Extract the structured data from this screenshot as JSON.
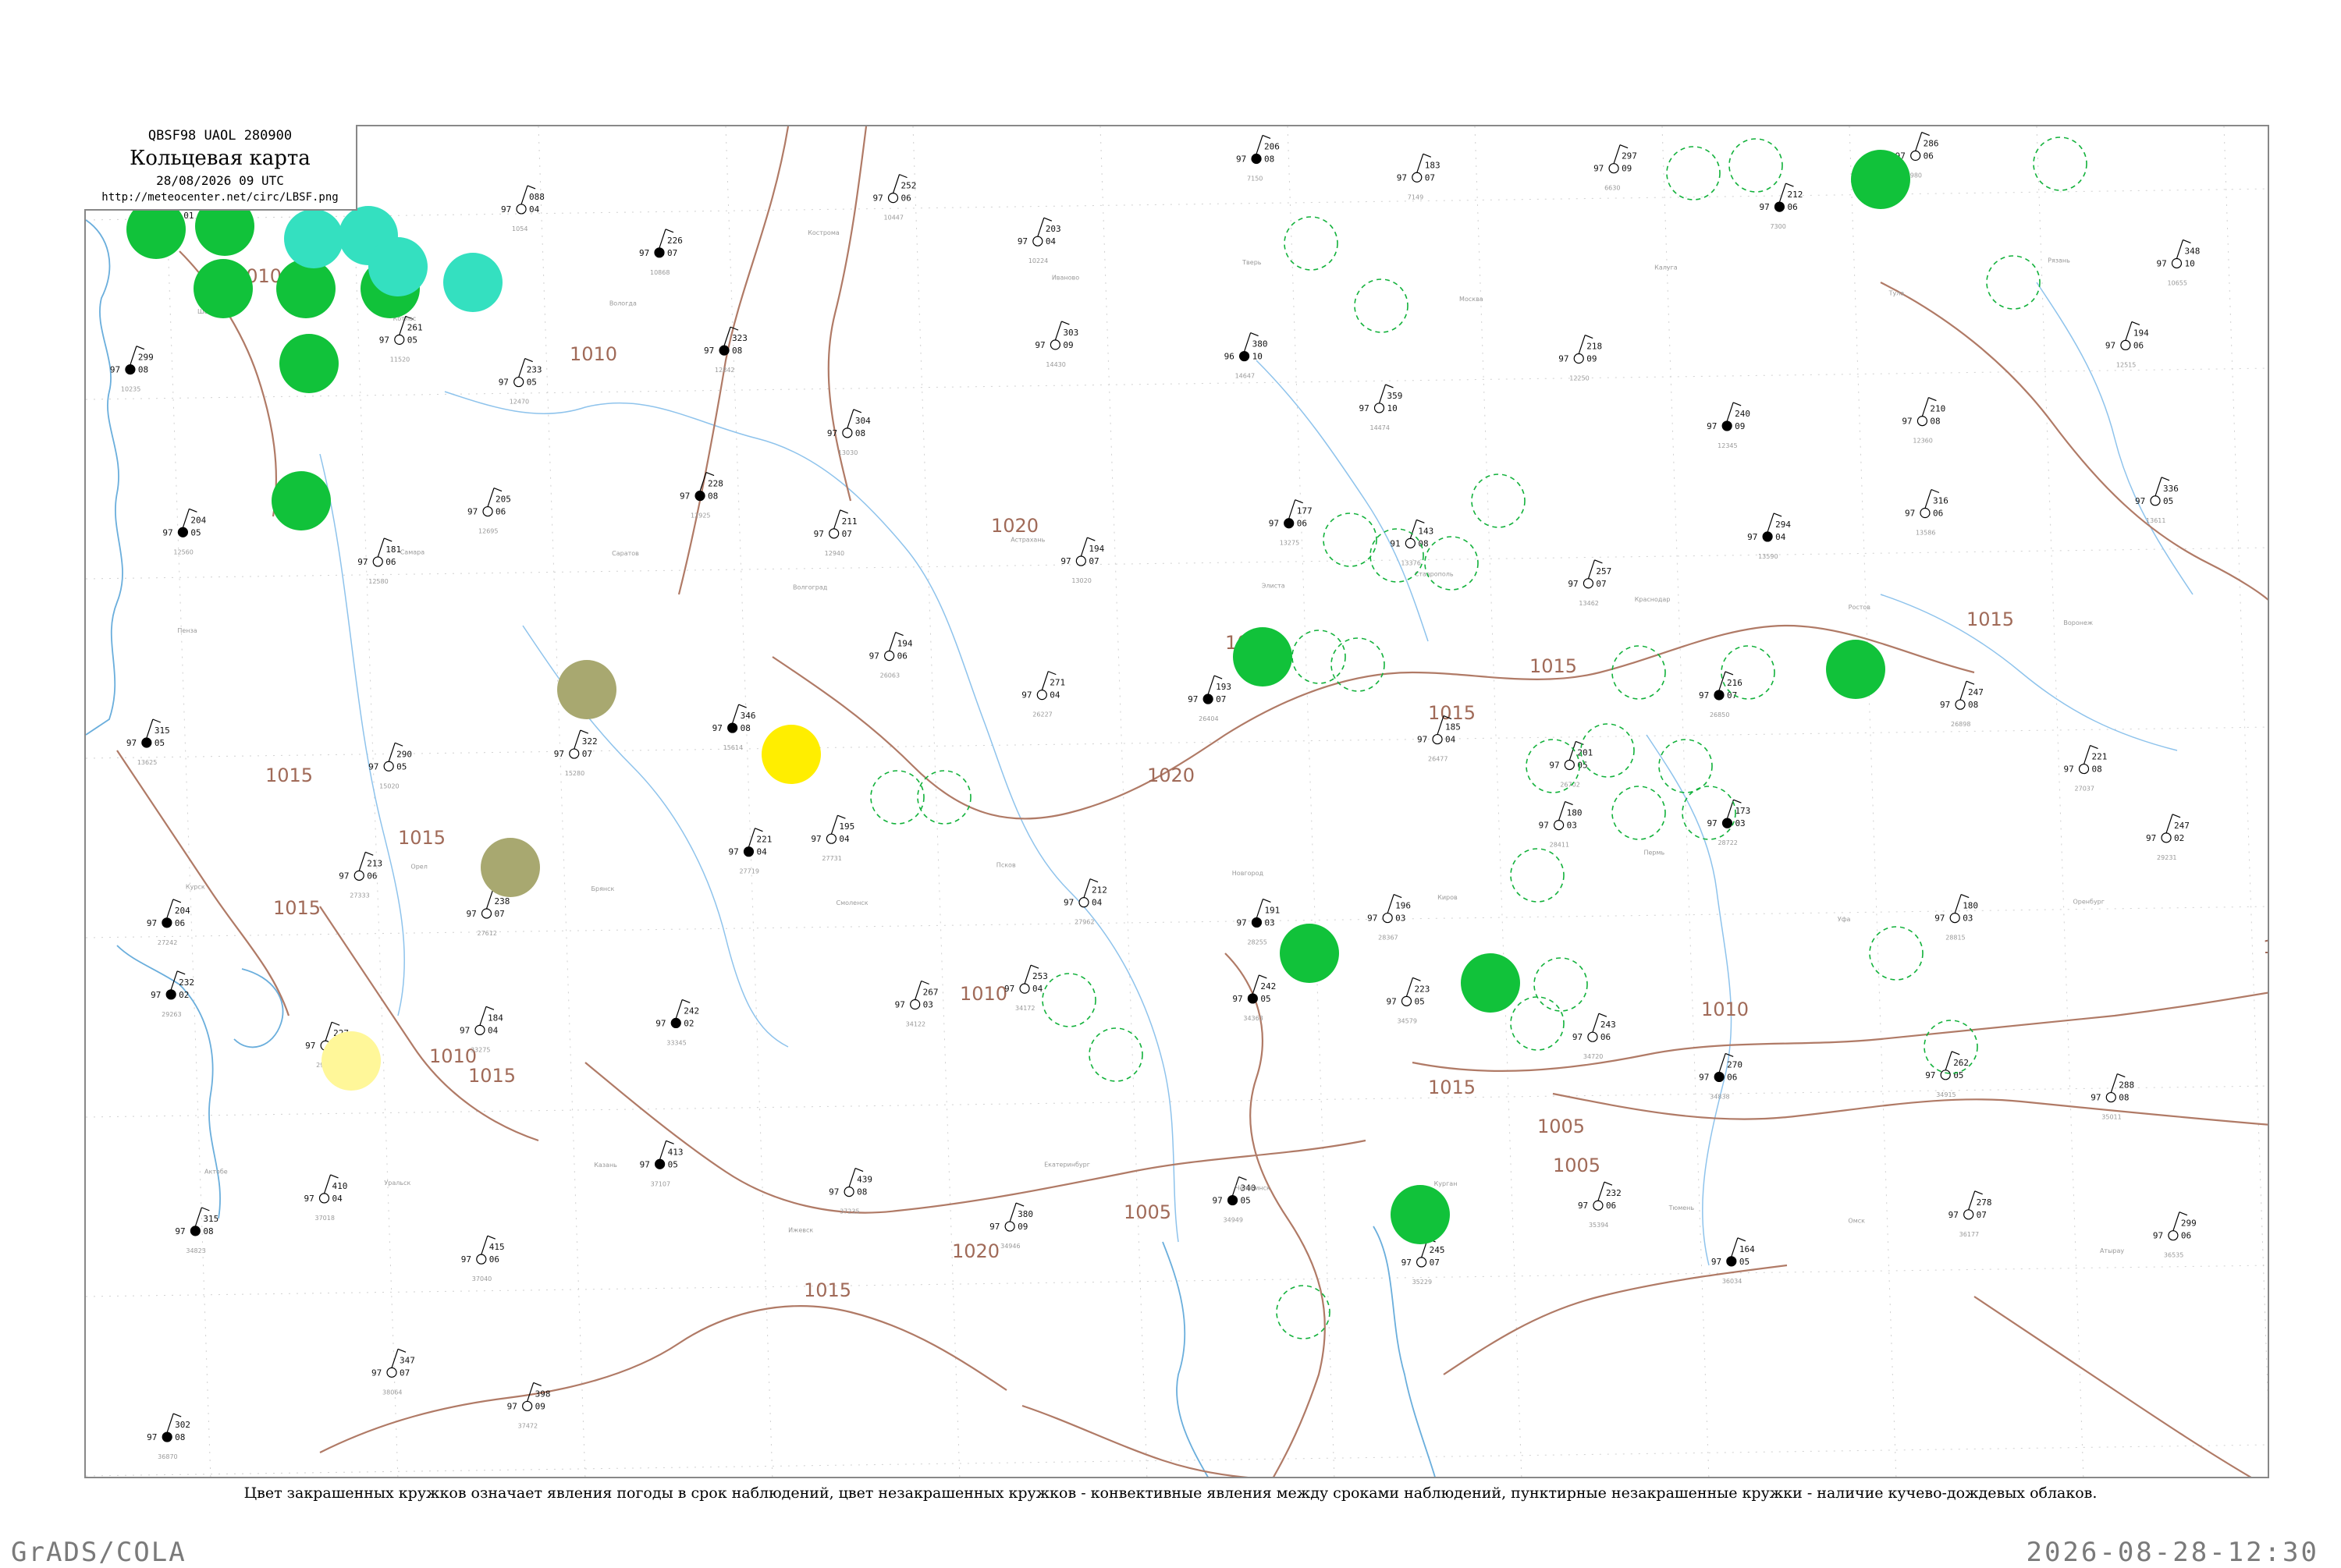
{
  "title": {
    "code": "QBSF98  UAOL  280900",
    "main": "Кольцевая карта",
    "date": "28/08/2026 09 UTC",
    "url": "http://meteocenter.net/circ/LBSF.png"
  },
  "caption": "Цвет закрашенных кружков означает явления погоды в срок наблюдений, цвет незакрашенных кружков - конвективные явления между сроками наблюдений, пунктирные незакрашенные кружки - наличие кучево-дождевых облаков.",
  "footer": {
    "left": "GrADS/COLA",
    "right": "2026-08-28-12:30"
  },
  "colors": {
    "isobar": "#b07a66",
    "water": "#6aaedc",
    "rain": "#11c23a",
    "shower_rain": "#34e0c0",
    "fog_olive": "#a8a870",
    "haze_yellow": "#ffee00",
    "pale_yellow": "#fff799",
    "cb_dashed": "#11b13a"
  },
  "isobar_labels": [
    {
      "text": "1010"
    },
    {
      "text": "1010"
    },
    {
      "text": "1010"
    },
    {
      "text": "1010"
    },
    {
      "text": "1015"
    },
    {
      "text": "1015"
    },
    {
      "text": "1015"
    },
    {
      "text": "1015"
    },
    {
      "text": "1015"
    },
    {
      "text": "1015"
    },
    {
      "text": "1015"
    },
    {
      "text": "1015"
    },
    {
      "text": "1020"
    },
    {
      "text": "1020"
    },
    {
      "text": "1020"
    },
    {
      "text": "1020"
    },
    {
      "text": "1005"
    },
    {
      "text": "1005"
    },
    {
      "text": "1005"
    },
    {
      "text": "1010"
    },
    {
      "text": "1010"
    },
    {
      "text": "1015"
    }
  ],
  "stations": [
    {
      "p": "109",
      "t": "97",
      "d": "-01",
      "id": "4221"
    },
    {
      "p": "099",
      "t": "97",
      "d": "05",
      "id": "2652"
    },
    {
      "p": "088",
      "t": "97",
      "d": "04",
      "id": "1054"
    },
    {
      "p": "226",
      "t": "97",
      "d": "07",
      "id": "10868"
    },
    {
      "p": "252",
      "t": "97",
      "d": "06",
      "id": "10447"
    },
    {
      "p": "203",
      "t": "97",
      "d": "04",
      "id": "10224"
    },
    {
      "p": "206",
      "t": "97",
      "d": "08",
      "id": "7150"
    },
    {
      "p": "183",
      "t": "97",
      "d": "07",
      "id": "7149"
    },
    {
      "p": "297",
      "t": "97",
      "d": "09",
      "id": "6630"
    },
    {
      "p": "212",
      "t": "97",
      "d": "06",
      "id": "7300"
    },
    {
      "p": "286",
      "t": "97",
      "d": "06",
      "id": "6980"
    },
    {
      "p": "348",
      "t": "97",
      "d": "10",
      "id": "10655"
    },
    {
      "p": "299",
      "t": "97",
      "d": "08",
      "id": "10235"
    },
    {
      "p": "261",
      "t": "97",
      "d": "05",
      "id": "11520"
    },
    {
      "p": "233",
      "t": "97",
      "d": "05",
      "id": "12470"
    },
    {
      "p": "323",
      "t": "97",
      "d": "08",
      "id": "12842"
    },
    {
      "p": "304",
      "t": "97",
      "d": "08",
      "id": "13030"
    },
    {
      "p": "303",
      "t": "97",
      "d": "09",
      "id": "14430"
    },
    {
      "p": "380",
      "t": "96",
      "d": "10",
      "id": "14647"
    },
    {
      "p": "359",
      "t": "97",
      "d": "10",
      "id": "14474"
    },
    {
      "p": "218",
      "t": "97",
      "d": "09",
      "id": "12250"
    },
    {
      "p": "240",
      "t": "97",
      "d": "09",
      "id": "12345"
    },
    {
      "p": "210",
      "t": "97",
      "d": "08",
      "id": "12360"
    },
    {
      "p": "194",
      "t": "97",
      "d": "06",
      "id": "12515"
    },
    {
      "p": "204",
      "t": "97",
      "d": "05",
      "id": "12560"
    },
    {
      "p": "181",
      "t": "97",
      "d": "06",
      "id": "12580"
    },
    {
      "p": "205",
      "t": "97",
      "d": "06",
      "id": "12695"
    },
    {
      "p": "228",
      "t": "97",
      "d": "08",
      "id": "12925"
    },
    {
      "p": "211",
      "t": "97",
      "d": "07",
      "id": "12940"
    },
    {
      "p": "194",
      "t": "97",
      "d": "07",
      "id": "13020"
    },
    {
      "p": "177",
      "t": "97",
      "d": "06",
      "id": "13275"
    },
    {
      "p": "143",
      "t": "91",
      "d": "08",
      "id": "13376"
    },
    {
      "p": "257",
      "t": "97",
      "d": "07",
      "id": "13462"
    },
    {
      "p": "294",
      "t": "97",
      "d": "04",
      "id": "13590"
    },
    {
      "p": "316",
      "t": "97",
      "d": "06",
      "id": "13586"
    },
    {
      "p": "336",
      "t": "97",
      "d": "05",
      "id": "13611"
    },
    {
      "p": "315",
      "t": "97",
      "d": "05",
      "id": "13625"
    },
    {
      "p": "290",
      "t": "97",
      "d": "05",
      "id": "15020"
    },
    {
      "p": "322",
      "t": "97",
      "d": "07",
      "id": "15280"
    },
    {
      "p": "346",
      "t": "97",
      "d": "08",
      "id": "15614"
    },
    {
      "p": "194",
      "t": "97",
      "d": "06",
      "id": "26063"
    },
    {
      "p": "271",
      "t": "97",
      "d": "04",
      "id": "26227"
    },
    {
      "p": "193",
      "t": "97",
      "d": "07",
      "id": "26404"
    },
    {
      "p": "185",
      "t": "97",
      "d": "04",
      "id": "26477"
    },
    {
      "p": "201",
      "t": "97",
      "d": "05",
      "id": "26702"
    },
    {
      "p": "216",
      "t": "97",
      "d": "07",
      "id": "26850"
    },
    {
      "p": "247",
      "t": "97",
      "d": "08",
      "id": "26898"
    },
    {
      "p": "221",
      "t": "97",
      "d": "08",
      "id": "27037"
    },
    {
      "p": "204",
      "t": "97",
      "d": "06",
      "id": "27242"
    },
    {
      "p": "213",
      "t": "97",
      "d": "06",
      "id": "27333"
    },
    {
      "p": "238",
      "t": "97",
      "d": "07",
      "id": "27612"
    },
    {
      "p": "221",
      "t": "97",
      "d": "04",
      "id": "27719"
    },
    {
      "p": "195",
      "t": "97",
      "d": "04",
      "id": "27731"
    },
    {
      "p": "212",
      "t": "97",
      "d": "04",
      "id": "27962"
    },
    {
      "p": "191",
      "t": "97",
      "d": "03",
      "id": "28255"
    },
    {
      "p": "196",
      "t": "97",
      "d": "03",
      "id": "28367"
    },
    {
      "p": "180",
      "t": "97",
      "d": "03",
      "id": "28411"
    },
    {
      "p": "173",
      "t": "97",
      "d": "03",
      "id": "28722"
    },
    {
      "p": "180",
      "t": "97",
      "d": "03",
      "id": "28815"
    },
    {
      "p": "247",
      "t": "97",
      "d": "02",
      "id": "29231"
    },
    {
      "p": "232",
      "t": "97",
      "d": "02",
      "id": "29263"
    },
    {
      "p": "227",
      "t": "97",
      "d": "02",
      "id": "29572"
    },
    {
      "p": "184",
      "t": "97",
      "d": "04",
      "id": "33275"
    },
    {
      "p": "242",
      "t": "97",
      "d": "02",
      "id": "33345"
    },
    {
      "p": "267",
      "t": "97",
      "d": "03",
      "id": "34122"
    },
    {
      "p": "253",
      "t": "97",
      "d": "04",
      "id": "34172"
    },
    {
      "p": "242",
      "t": "97",
      "d": "05",
      "id": "34363"
    },
    {
      "p": "223",
      "t": "97",
      "d": "05",
      "id": "34579"
    },
    {
      "p": "243",
      "t": "97",
      "d": "06",
      "id": "34720"
    },
    {
      "p": "270",
      "t": "97",
      "d": "06",
      "id": "34838"
    },
    {
      "p": "262",
      "t": "97",
      "d": "05",
      "id": "34915"
    },
    {
      "p": "288",
      "t": "97",
      "d": "08",
      "id": "35011"
    },
    {
      "p": "315",
      "t": "97",
      "d": "08",
      "id": "34823"
    },
    {
      "p": "410",
      "t": "97",
      "d": "04",
      "id": "37018"
    },
    {
      "p": "415",
      "t": "97",
      "d": "06",
      "id": "37040"
    },
    {
      "p": "413",
      "t": "97",
      "d": "05",
      "id": "37107"
    },
    {
      "p": "439",
      "t": "97",
      "d": "08",
      "id": "37235"
    },
    {
      "p": "380",
      "t": "97",
      "d": "09",
      "id": "34946"
    },
    {
      "p": "340",
      "t": "97",
      "d": "05",
      "id": "34949"
    },
    {
      "p": "245",
      "t": "97",
      "d": "07",
      "id": "35229"
    },
    {
      "p": "232",
      "t": "97",
      "d": "06",
      "id": "35394"
    },
    {
      "p": "164",
      "t": "97",
      "d": "05",
      "id": "36034"
    },
    {
      "p": "278",
      "t": "97",
      "d": "07",
      "id": "36177"
    },
    {
      "p": "299",
      "t": "97",
      "d": "06",
      "id": "36535"
    },
    {
      "p": "302",
      "t": "97",
      "d": "08",
      "id": "36870"
    },
    {
      "p": "347",
      "t": "97",
      "d": "07",
      "id": "38064"
    },
    {
      "p": "398",
      "t": "97",
      "d": "09",
      "id": "37472"
    }
  ],
  "station_names": [
    "Шенкурск",
    "Котлас",
    "Вологда",
    "Кострома",
    "Иваново",
    "Тверь",
    "Москва",
    "Калуга",
    "Тула",
    "Рязань",
    "Пенза",
    "Самара",
    "Саратов",
    "Волгоград",
    "Астрахань",
    "Элиста",
    "Ставрополь",
    "Краснодар",
    "Ростов",
    "Воронеж",
    "Курск",
    "Орел",
    "Брянск",
    "Смоленск",
    "Псков",
    "Новгород",
    "Киров",
    "Пермь",
    "Уфа",
    "Оренбург",
    "Актобе",
    "Уральск",
    "Казань",
    "Ижевск",
    "Екатеринбург",
    "Челябинск",
    "Курган",
    "Тюмень",
    "Омск",
    "Атырау"
  ]
}
